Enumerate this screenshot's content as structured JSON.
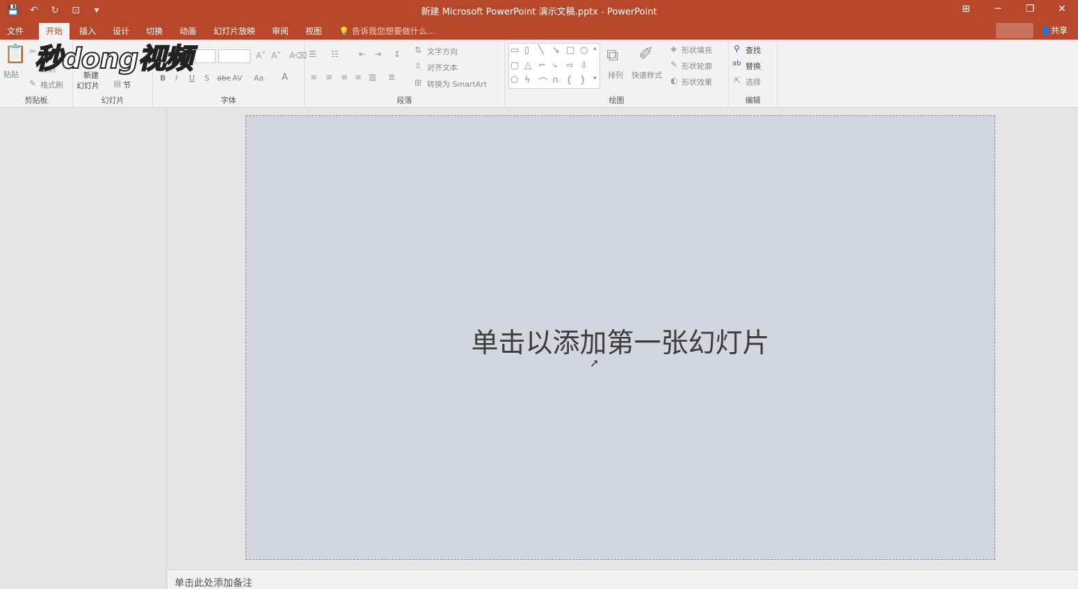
{
  "window": {
    "title": "新建 Microsoft PowerPoint 演示文稿.pptx - PowerPoint",
    "controls": {
      "ribbon_display": "⊞",
      "minimize": "─",
      "restore": "❐",
      "close": "✕"
    }
  },
  "qat": {
    "save": "💾",
    "undo": "↶",
    "redo": "↻",
    "present": "⊡",
    "customize": "▾"
  },
  "tabs": [
    "文件",
    "开始",
    "插入",
    "设计",
    "切换",
    "动画",
    "幻灯片放映",
    "审阅",
    "视图"
  ],
  "active_tab": "开始",
  "tell_me": "告诉我您想要做什么...",
  "share": "共享",
  "watermark": "秒dong视频",
  "ribbon": {
    "clipboard": {
      "label": "剪贴板",
      "paste": "粘贴",
      "copy": "复制",
      "format_painter": "格式刷"
    },
    "slides": {
      "label": "幻灯片",
      "new_slide_line1": "新建",
      "new_slide_line2": "幻灯片",
      "section": "节"
    },
    "font": {
      "label": "字体",
      "bold": "B",
      "italic": "I",
      "underline": "U",
      "shadow": "S",
      "strike": "abc",
      "spacing": "AV",
      "case": "Aa",
      "color": "A"
    },
    "paragraph": {
      "label": "段落",
      "text_direction": "文字方向",
      "align_text": "对齐文本",
      "smartart": "转换为 SmartArt"
    },
    "drawing": {
      "label": "绘图",
      "arrange": "排列",
      "quick_styles": "快速样式",
      "shape_fill": "形状填充",
      "shape_outline": "形状轮廓",
      "shape_effects": "形状效果"
    },
    "editing": {
      "label": "编辑",
      "find": "查找",
      "replace": "替换",
      "select": "选择"
    }
  },
  "slide": {
    "placeholder": "单击以添加第一张幻灯片"
  },
  "notes": {
    "placeholder": "单击此处添加备注"
  },
  "colors": {
    "accent": "#b7472a",
    "slide_bg": "#d2d6df",
    "ribbon_bg": "#f3f3f3"
  }
}
